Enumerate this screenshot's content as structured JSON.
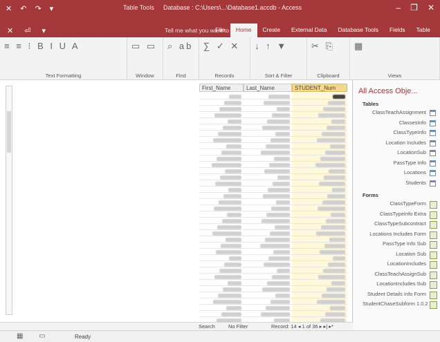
{
  "window": {
    "title": "Database : C:\\Users\\...\\Database1.accdb - Access",
    "tools_label": "Table Tools",
    "controls": [
      "–",
      "❐",
      "✕"
    ],
    "qat": [
      "✕",
      "↶",
      "↷",
      "▾"
    ]
  },
  "ribbon_tabs": {
    "left": [
      "✕",
      "⏎",
      "▾"
    ],
    "tell_me": "Tell me what you want to do",
    "tabs": [
      "File",
      "Home",
      "Create",
      "External Data",
      "Database Tools",
      "Fields",
      "Table"
    ],
    "active_index": 1
  },
  "ribbon_groups": [
    {
      "label": "Text Formatting",
      "glyphs": "≡ ≡ ⁝ B I U A"
    },
    {
      "label": "Window",
      "glyphs": "▭ ▭"
    },
    {
      "label": "Find",
      "glyphs": "⌕ ab"
    },
    {
      "label": "Records",
      "glyphs": "∑ ✓ ✕"
    },
    {
      "label": "Sort & Filter",
      "glyphs": "↓ ↑ ▼"
    },
    {
      "label": "Clipboard",
      "glyphs": "✂ ⎘"
    },
    {
      "label": "Views",
      "glyphs": "▦"
    }
  ],
  "grid": {
    "columns": [
      "First_Name",
      "Last_Name",
      "STUDENT_Num"
    ],
    "selected_column": 2,
    "row_count": 37
  },
  "record_nav": {
    "record_label": "Record: 14 ◂ 1 of 36 ▸ ▸| ▸*",
    "filter_label": "No Filter",
    "search_label": "Search"
  },
  "nav_pane": {
    "title": "All Access Obje...",
    "sections": [
      {
        "label": "Tables",
        "items": [
          "ClassTeachAssignment",
          "ClassesInfo",
          "ClassTypeInfo",
          "Location Includes",
          "LocationSub",
          "PassType Info",
          "Locations",
          "Students"
        ]
      },
      {
        "label": "Forms",
        "items": [
          "ClassTypeForm",
          "ClassTypeInfo Extra",
          "ClassTypeSubcontract",
          "Locations Includes Form",
          "PassType Info Sub",
          "Location Sub",
          "LocationIncludes",
          "ClassTeachAssignSub",
          "LocationIncludes Sub",
          "Student Details Info Form",
          "StudentChaseSubform 1.0.2"
        ]
      }
    ]
  },
  "status": {
    "ready": "Ready",
    "view_icons": "▦ ▭"
  },
  "colors": {
    "accent": "#a4373a",
    "selected_header": "#f5d98a"
  }
}
